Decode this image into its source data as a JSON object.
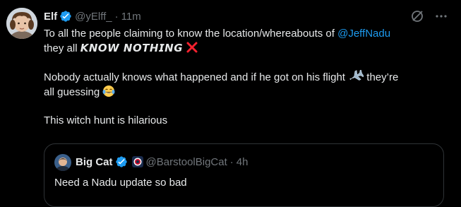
{
  "tweet": {
    "author": {
      "display_name": "Elf",
      "handle": "@yElff_",
      "verified": true
    },
    "separator": "·",
    "time": "11m",
    "body": {
      "line1_prefix": "To all the people claiming to know the location/whereabouts of ",
      "mention": "@JeffNadu",
      "line2_prefix": "they all ",
      "emphasis": "𝙆𝙉𝙊𝙒 𝙉𝙊𝙏𝙃𝙄𝙉𝙂",
      "paragraph2_a": "Nobody actually knows what happened and if he got on his flight",
      "paragraph2_b": "they’re",
      "paragraph2_c": "all guessing",
      "paragraph3": "This witch hunt is hilarious"
    },
    "icons": {
      "cross": "cross-mark-icon",
      "airplane": "airplane-icon",
      "laugh": "tears-of-joy-icon",
      "grok": "grok-icon",
      "more": "more-icon"
    }
  },
  "quote": {
    "author": {
      "display_name": "Big Cat",
      "handle": "@BarstoolBigCat",
      "verified": true
    },
    "separator": "·",
    "time": "4h",
    "text": "Need a Nadu update so bad"
  },
  "colors": {
    "background": "#000000",
    "text": "#e7e9ea",
    "secondary": "#71767b",
    "accent": "#1d9bf0",
    "border": "#2f3336",
    "cross": "#f4212e"
  }
}
